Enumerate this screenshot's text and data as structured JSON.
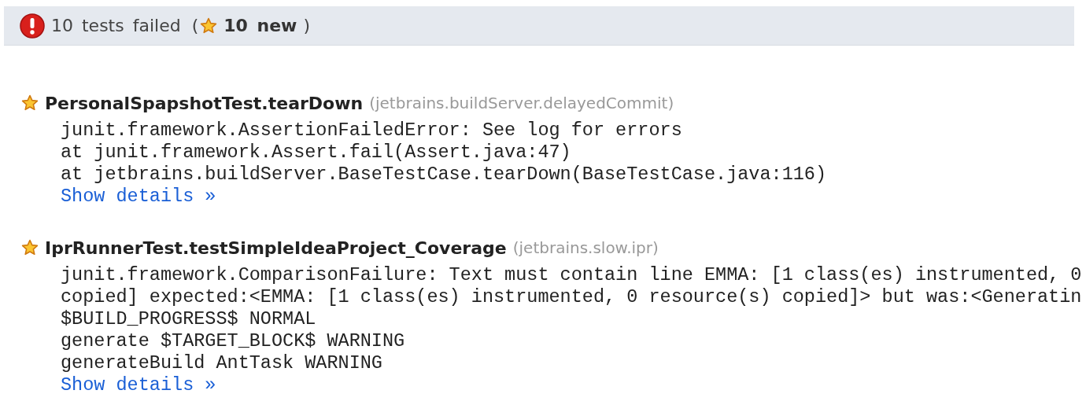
{
  "summary": {
    "failed_text": "10 tests failed",
    "open_paren": "(",
    "new_count": "10 new",
    "close_paren": ")"
  },
  "tests": [
    {
      "new": true,
      "name": "PersonalSpapshotTest.tearDown",
      "package": "(jetbrains.buildServer.delayedCommit)",
      "lines": [
        "junit.framework.AssertionFailedError: See log for errors",
        "at junit.framework.Assert.fail(Assert.java:47)",
        "at jetbrains.buildServer.BaseTestCase.tearDown(BaseTestCase.java:116)"
      ],
      "details_link": "Show details »"
    },
    {
      "new": true,
      "name": "IprRunnerTest.testSimpleIdeaProject_Coverage",
      "package": "(jetbrains.slow.ipr)",
      "lines": [
        "junit.framework.ComparisonFailure: Text must contain line EMMA: [1 class(es) instrumented, 0",
        "copied] expected:<EMMA: [1 class(es) instrumented, 0 resource(s) copied]> but was:<Generatin",
        "$BUILD_PROGRESS$ NORMAL",
        "generate $TARGET_BLOCK$ WARNING",
        "generateBuild AntTask WARNING"
      ],
      "details_link": "Show details »"
    }
  ]
}
